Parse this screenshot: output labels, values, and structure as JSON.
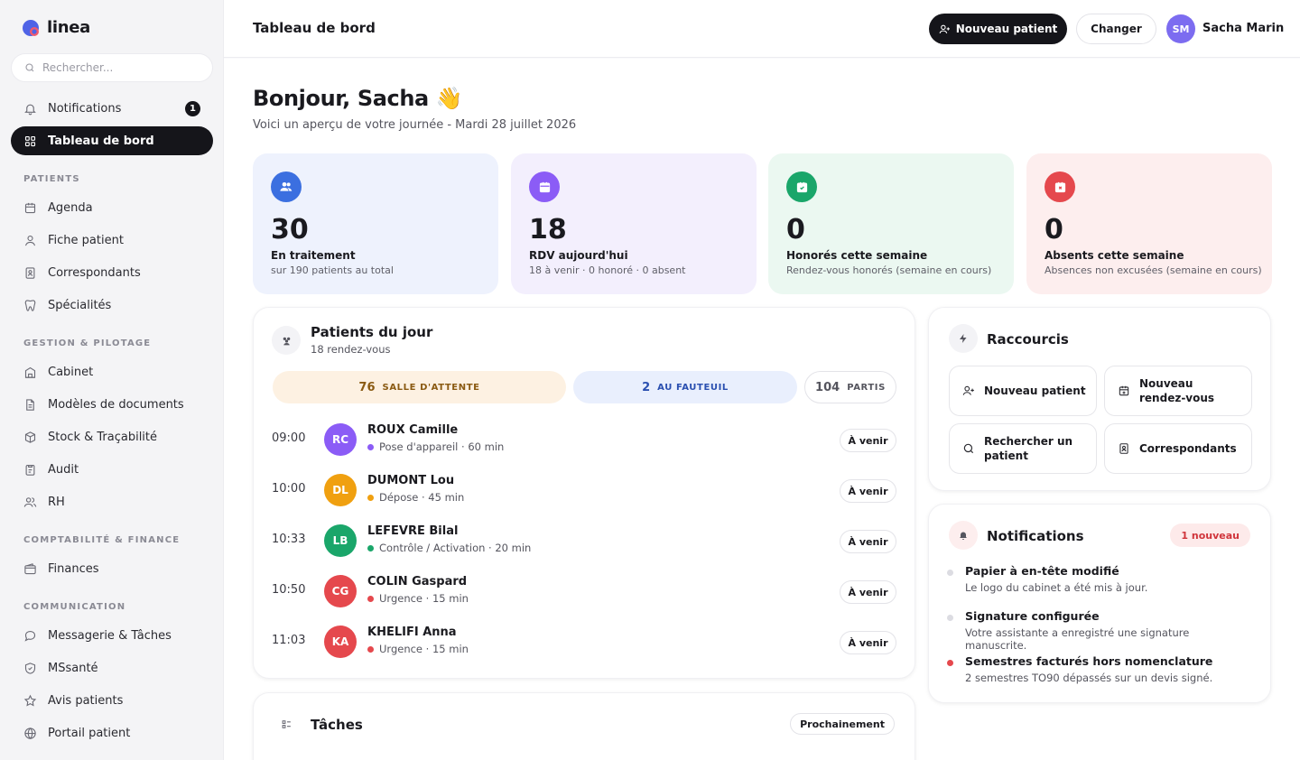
{
  "brand": {
    "name": "linea"
  },
  "search": {
    "placeholder": "Rechercher..."
  },
  "sidebar": {
    "notifications": {
      "label": "Notifications",
      "count": "1"
    },
    "dashboard": {
      "label": "Tableau de bord"
    },
    "sections": [
      {
        "title": "PATIENTS",
        "items": [
          {
            "label": "Agenda",
            "icon": "calendar-icon"
          },
          {
            "label": "Fiche patient",
            "icon": "user-icon"
          },
          {
            "label": "Correspondants",
            "icon": "contact-card-icon"
          },
          {
            "label": "Spécialités",
            "icon": "tooth-icon"
          }
        ]
      },
      {
        "title": "GESTION & PILOTAGE",
        "items": [
          {
            "label": "Cabinet",
            "icon": "building-icon"
          },
          {
            "label": "Modèles de documents",
            "icon": "document-icon"
          },
          {
            "label": "Stock & Traçabilité",
            "icon": "box-icon"
          },
          {
            "label": "Audit",
            "icon": "clipboard-icon"
          },
          {
            "label": "RH",
            "icon": "users-icon"
          }
        ]
      },
      {
        "title": "COMPTABILITÉ & FINANCE",
        "items": [
          {
            "label": "Finances",
            "icon": "wallet-icon"
          }
        ]
      },
      {
        "title": "COMMUNICATION",
        "items": [
          {
            "label": "Messagerie & Tâches",
            "icon": "chat-icon"
          },
          {
            "label": "MSsanté",
            "icon": "shield-icon"
          },
          {
            "label": "Avis patients",
            "icon": "star-icon"
          },
          {
            "label": "Portail patient",
            "icon": "globe-icon"
          }
        ]
      }
    ]
  },
  "header": {
    "title": "Tableau de bord",
    "new_patient": "Nouveau patient",
    "change": "Changer",
    "user_initials": "SM",
    "user_name": "Sacha Marin"
  },
  "greeting": {
    "title": "Bonjour, Sacha 👋",
    "subtitle": "Voici un aperçu de votre journée - Mardi 28 juillet 2026"
  },
  "stats": [
    {
      "value": "30",
      "label": "En traitement",
      "sub": "sur 190 patients au total",
      "bg": "#eef2fd",
      "accent": "#3b6fe0"
    },
    {
      "value": "18",
      "label": "RDV aujourd'hui",
      "sub": "18 à venir · 0 honoré · 0 absent",
      "bg": "#f3effd",
      "accent": "#8b5cf6"
    },
    {
      "value": "0",
      "label": "Honorés cette semaine",
      "sub": "Rendez-vous honorés (semaine en cours)",
      "bg": "#ebf8f1",
      "accent": "#1aa66a"
    },
    {
      "value": "0",
      "label": "Absents cette semaine",
      "sub": "Absences non excusées (semaine en cours)",
      "bg": "#fdeeee",
      "accent": "#e5484d"
    }
  ],
  "patients_day": {
    "title": "Patients du jour",
    "subtitle": "18 rendez-vous",
    "pills": [
      {
        "count": "76",
        "label": "SALLE D'ATTENTE",
        "bg": "#fdf1e2",
        "color": "#8a5a12"
      },
      {
        "count": "2",
        "label": "AU FAUTEUIL",
        "bg": "#e9effd",
        "color": "#2a4fb0"
      },
      {
        "count": "104",
        "label": "PARTIS",
        "bg": "#ffffff",
        "color": "#55555e"
      }
    ],
    "appointments": [
      {
        "time": "09:00",
        "initials": "RC",
        "name": "ROUX Camille",
        "detail": "Pose d'appareil · 60 min",
        "color": "#8b5cf6",
        "dot": "#8b5cf6",
        "status": "À venir"
      },
      {
        "time": "10:00",
        "initials": "DL",
        "name": "DUMONT Lou",
        "detail": "Dépose · 45 min",
        "color": "#f0a010",
        "dot": "#f0a010",
        "status": "À venir"
      },
      {
        "time": "10:33",
        "initials": "LB",
        "name": "LEFEVRE Bilal",
        "detail": "Contrôle / Activation · 20 min",
        "color": "#1aa66a",
        "dot": "#1aa66a",
        "status": "À venir"
      },
      {
        "time": "10:50",
        "initials": "CG",
        "name": "COLIN Gaspard",
        "detail": "Urgence · 15 min",
        "color": "#e5484d",
        "dot": "#e5484d",
        "status": "À venir"
      },
      {
        "time": "11:03",
        "initials": "KA",
        "name": "KHELIFI Anna",
        "detail": "Urgence · 15 min",
        "color": "#e5484d",
        "dot": "#e5484d",
        "status": "À venir"
      }
    ]
  },
  "tasks": {
    "title": "Tâches",
    "badge": "Prochainement"
  },
  "shortcuts": {
    "title": "Raccourcis",
    "items": [
      {
        "label": "Nouveau patient",
        "icon": "user-plus-icon"
      },
      {
        "label": "Nouveau rendez-vous",
        "icon": "calendar-plus-icon"
      },
      {
        "label": "Rechercher un patient",
        "icon": "search-icon"
      },
      {
        "label": "Correspondants",
        "icon": "contact-card-icon"
      }
    ]
  },
  "notifications": {
    "title": "Notifications",
    "badge": "1 nouveau",
    "items": [
      {
        "title": "Papier à en-tête modifié",
        "sub": "Le logo du cabinet a été mis à jour.",
        "dot": "#dcdce2"
      },
      {
        "title": "Signature configurée",
        "sub": "Votre assistante a enregistré une signature manuscrite.",
        "dot": "#dcdce2"
      },
      {
        "title": "Semestres facturés hors nomenclature",
        "sub": "2 semestres TO90 dépassés sur un devis signé.",
        "dot": "#e5484d"
      }
    ]
  }
}
